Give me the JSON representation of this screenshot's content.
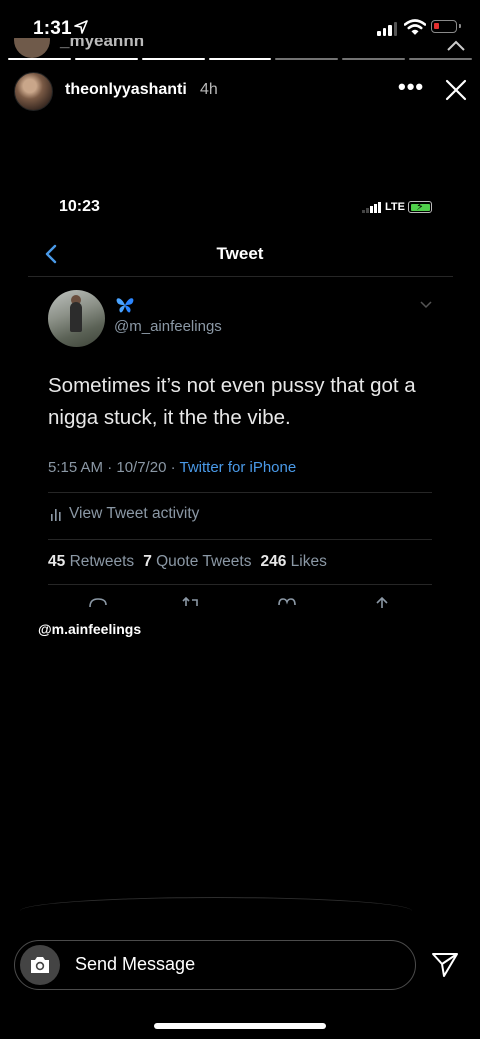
{
  "status_bar": {
    "time": "1:31"
  },
  "ghost_header": {
    "username": "_myeahhh"
  },
  "story": {
    "username": "theonlyyashanti",
    "age": "4h",
    "more": "•••"
  },
  "inner_status": {
    "time": "10:23",
    "network": "LTE"
  },
  "tweet_page": {
    "title": "Tweet"
  },
  "tweet": {
    "handle": "@m_ainfeelings",
    "text": "Sometimes it’s not even pussy that got a nigga stuck, it the the vibe.",
    "timestamp": "5:15 AM · 10/7/20 ·",
    "source": "Twitter for iPhone",
    "activity_label": "View Tweet activity",
    "stats": {
      "retweets_count": "45",
      "retweets_label": "Retweets",
      "quotes_count": "7",
      "quotes_label": "Quote Tweets",
      "likes_count": "246",
      "likes_label": "Likes"
    }
  },
  "credit": "@m.ainfeelings",
  "reply_bar": {
    "placeholder": "Send Message"
  },
  "colors": {
    "link": "#4a9ae8",
    "muted": "#8b98a5",
    "battery_low": "#e53030",
    "battery_charging": "#4fcf4a"
  },
  "icons": [
    "location-arrow-icon",
    "signal-icon",
    "wifi-icon",
    "battery-icon",
    "more-icon",
    "close-icon",
    "back-chevron-icon",
    "butterfly-icon",
    "caret-down-icon",
    "bar-chart-icon",
    "reply-icon",
    "retweet-icon",
    "heart-icon",
    "share-icon",
    "camera-icon",
    "send-icon"
  ]
}
